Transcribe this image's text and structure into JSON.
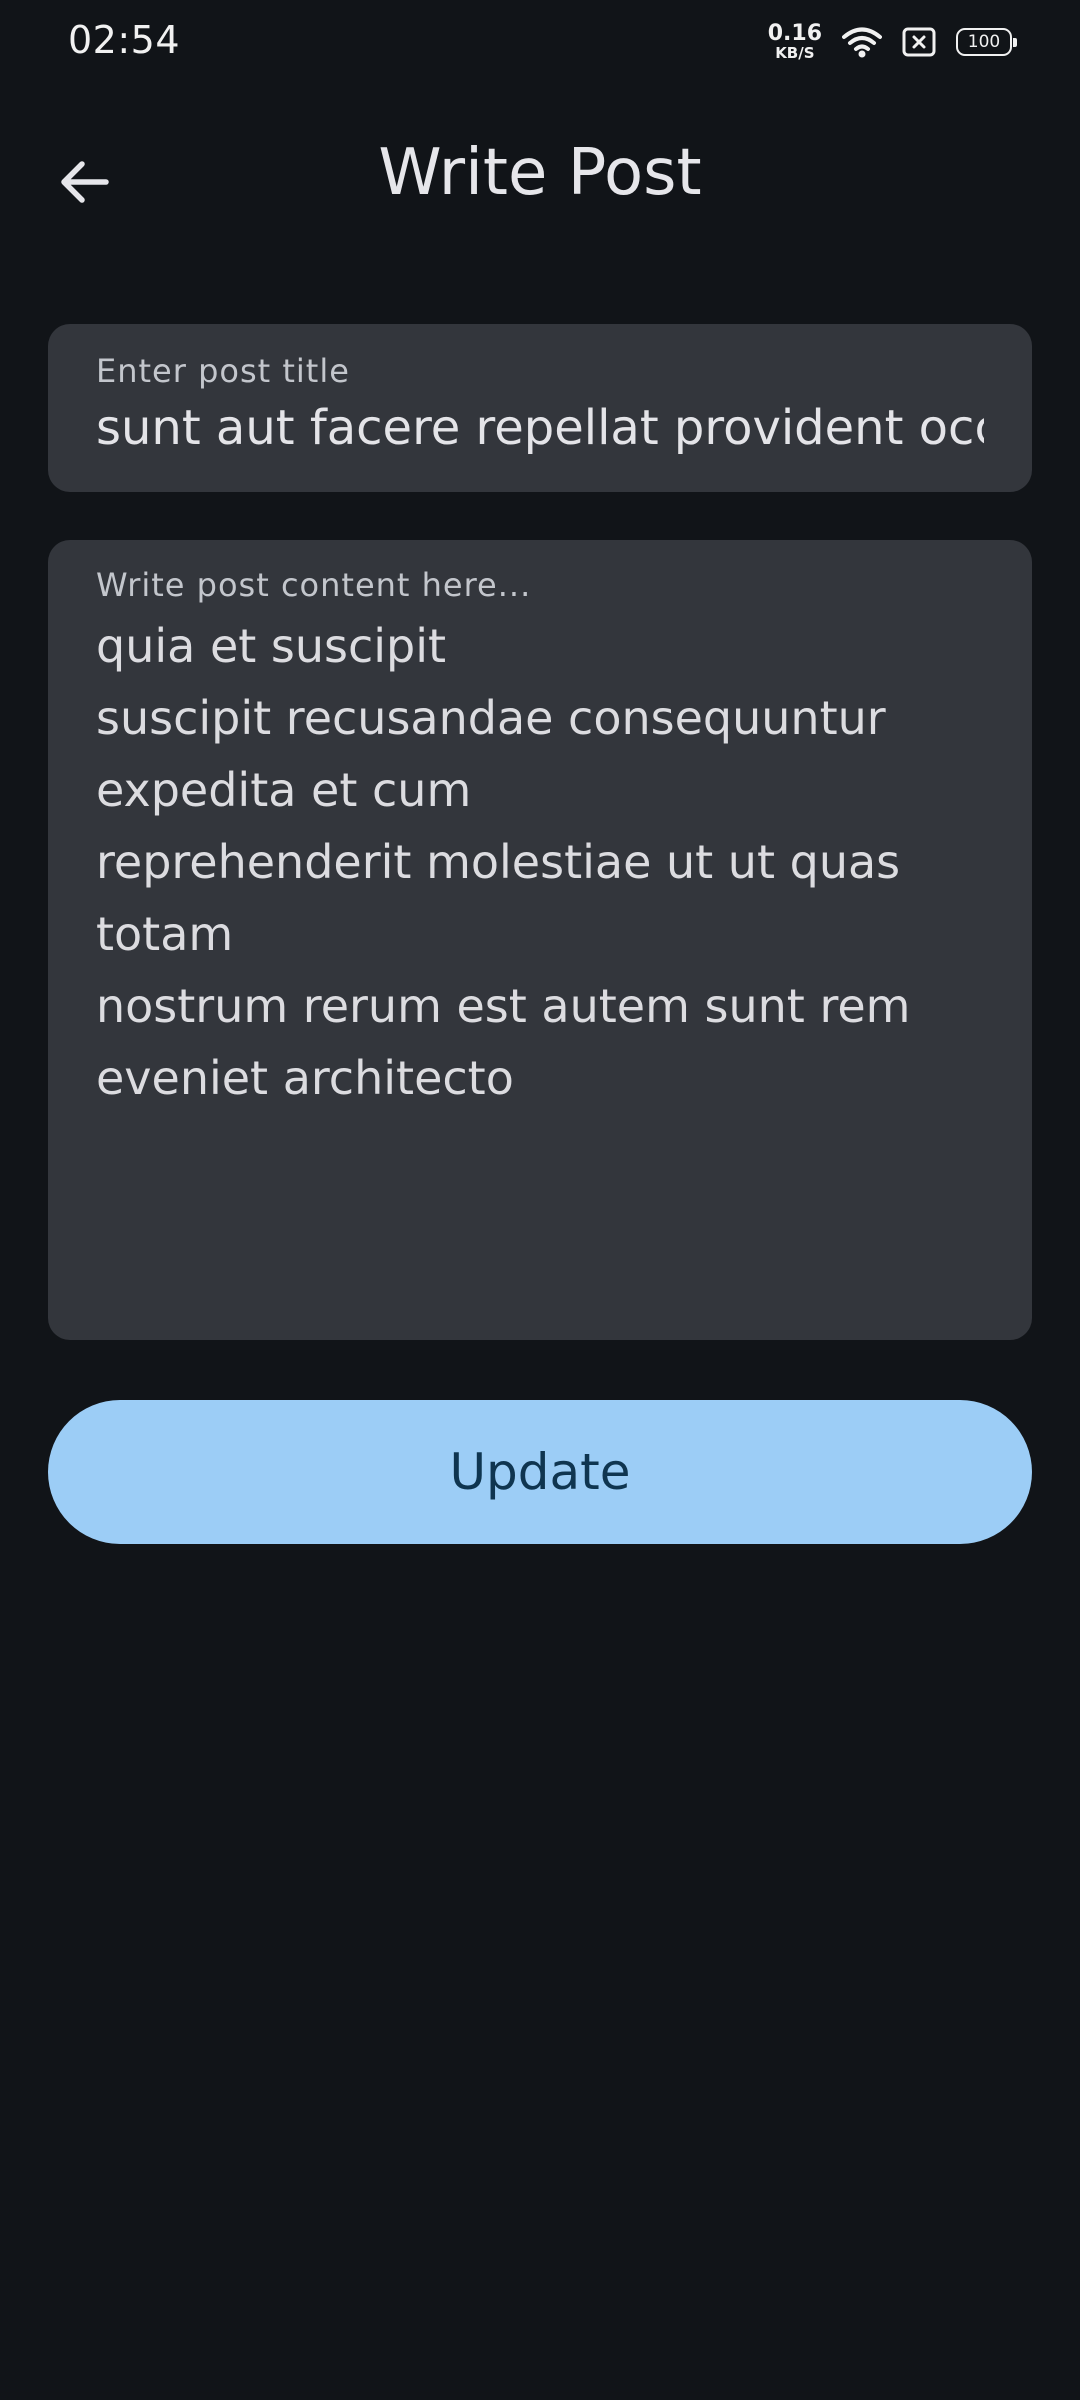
{
  "status_bar": {
    "time": "02:54",
    "net_speed_value": "0.16",
    "net_speed_unit": "KB/S",
    "battery_level": "100",
    "icons": [
      "wifi-icon",
      "sim-none-icon",
      "battery-icon"
    ]
  },
  "app_bar": {
    "title": "Write Post",
    "back_icon": "arrow-back-icon"
  },
  "form": {
    "title_label": "Enter post title",
    "title_value": "sunt aut facere repellat provident occaecati excepturi optio reprehenderit",
    "content_label": "Write post content here...",
    "content_lines": [
      "quia et suscipit",
      "suscipit recusandae consequuntur",
      "expedita et cum",
      "reprehenderit molestiae ut ut quas",
      "totam",
      "nostrum rerum est autem sunt rem",
      "eveniet architecto"
    ],
    "submit_label": "Update"
  },
  "colors": {
    "background": "#111418",
    "field_background": "#33363c",
    "button_background": "#9ccdf6",
    "button_text": "#0f3550"
  }
}
